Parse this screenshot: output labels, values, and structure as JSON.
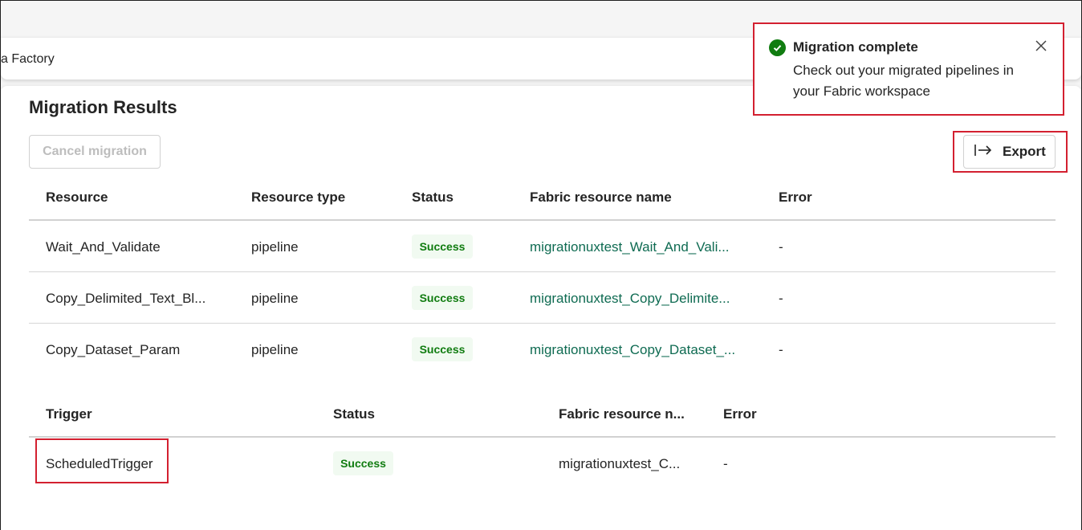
{
  "app": {
    "factory_title_fragment": "a Factory"
  },
  "page": {
    "title": "Migration Results"
  },
  "toolbar": {
    "cancel_label": "Cancel migration",
    "export_label": "Export",
    "export_icon": "arrow-right-to-bar-icon"
  },
  "resources_table": {
    "headers": [
      "Resource",
      "Resource type",
      "Status",
      "Fabric resource name",
      "Error"
    ],
    "rows": [
      {
        "resource": "Wait_And_Validate",
        "type": "pipeline",
        "status": "Success",
        "fabric_name": "migrationuxtest_Wait_And_Vali...",
        "error": "-"
      },
      {
        "resource": "Copy_Delimited_Text_Bl...",
        "type": "pipeline",
        "status": "Success",
        "fabric_name": "migrationuxtest_Copy_Delimite...",
        "error": "-"
      },
      {
        "resource": "Copy_Dataset_Param",
        "type": "pipeline",
        "status": "Success",
        "fabric_name": "migrationuxtest_Copy_Dataset_...",
        "error": "-"
      }
    ]
  },
  "triggers_table": {
    "headers": [
      "Trigger",
      "Status",
      "Fabric resource n...",
      "Error"
    ],
    "rows": [
      {
        "trigger": "ScheduledTrigger",
        "status": "Success",
        "fabric_name": "migrationuxtest_C...",
        "error": "-"
      }
    ]
  },
  "toast": {
    "title": "Migration complete",
    "body": "Check out your migrated pipelines in your Fabric workspace",
    "icon": "checkmark-circle-icon",
    "close_icon": "close-icon"
  },
  "colors": {
    "success_text": "#107c10",
    "success_bg": "#f1faf1",
    "link": "#0f6b52",
    "highlight": "#d32030"
  }
}
